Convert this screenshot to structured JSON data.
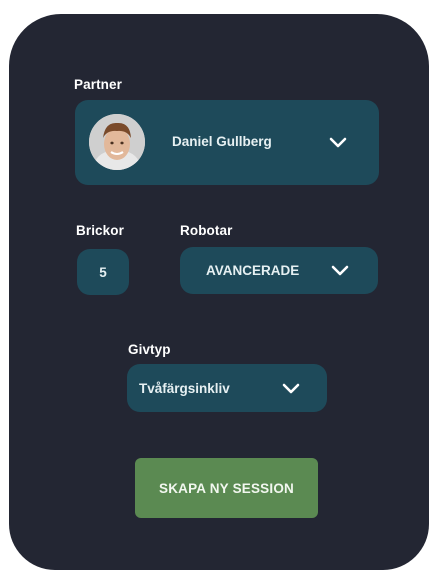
{
  "partner": {
    "label": "Partner",
    "name": "Daniel Gullberg"
  },
  "brickor": {
    "label": "Brickor",
    "value": "5"
  },
  "robotar": {
    "label": "Robotar",
    "value": "AVANCERADE"
  },
  "givtyp": {
    "label": "Givtyp",
    "value": "Tvåfärgsinkliv"
  },
  "actions": {
    "create_session_label": "SKAPA NY SESSION"
  },
  "icons": {
    "dropdown": "chevron-down-icon",
    "avatar": "user-avatar"
  },
  "colors": {
    "panel_bg": "#232633",
    "field_bg": "#1e4a5a",
    "button_bg": "#5b8a52"
  }
}
